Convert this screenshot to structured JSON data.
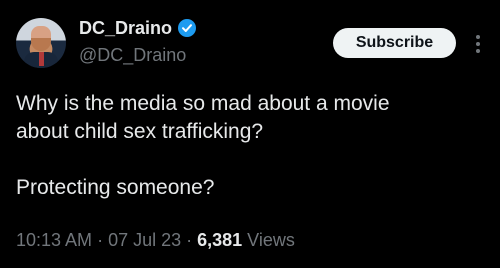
{
  "author": {
    "display_name": "DC_Draino",
    "handle": "@DC_Draino",
    "verified": true,
    "avatar_icon": "profile-photo"
  },
  "actions": {
    "subscribe_label": "Subscribe",
    "more_icon": "more-vertical-icon"
  },
  "tweet": {
    "text": "Why is the media so mad about a movie\nabout child sex trafficking?\n\nProtecting someone?",
    "time": "10:13 AM",
    "separator": "·",
    "date": "07 Jul 23",
    "views_count": "6,381",
    "views_label": "Views"
  },
  "colors": {
    "background": "#000000",
    "text": "#e7e9ea",
    "muted": "#71767b",
    "verified_blue": "#1d9bf0",
    "button_bg": "#eff3f4"
  }
}
